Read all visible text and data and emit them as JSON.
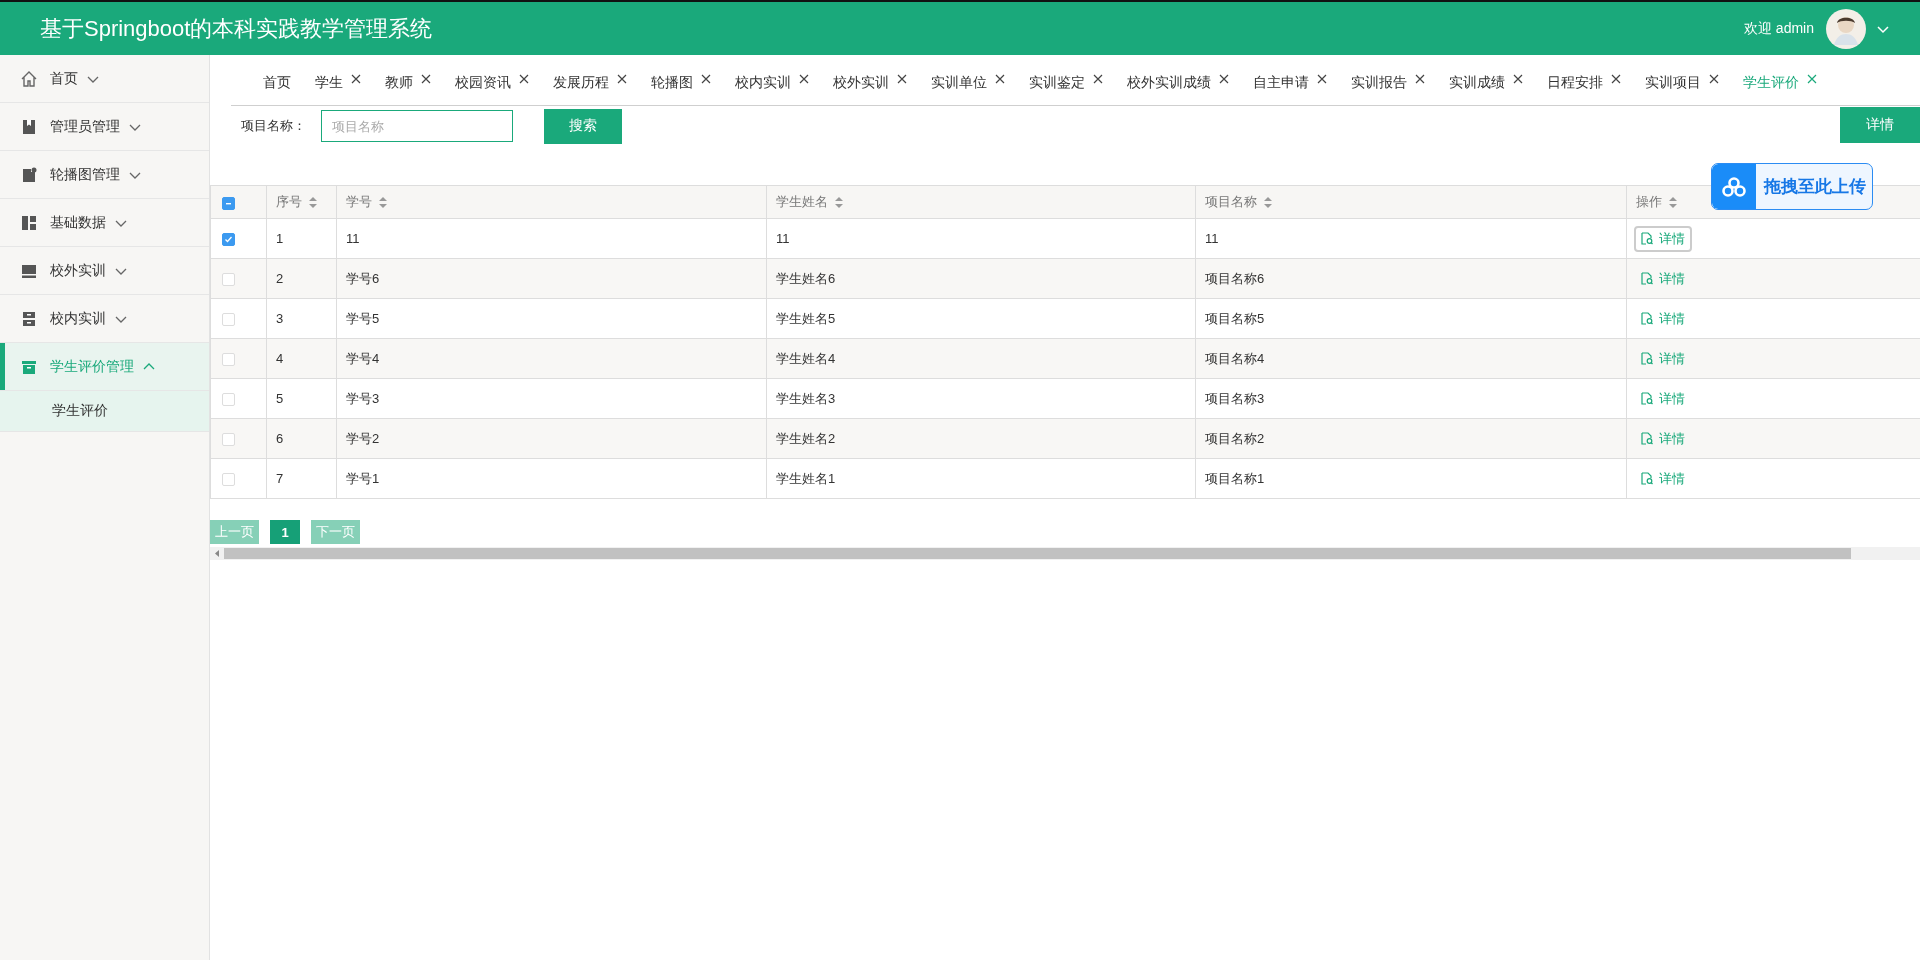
{
  "header": {
    "title": "基于Springboot的本科实践教学管理系统",
    "welcome": "欢迎 admin"
  },
  "sidebar": {
    "items": [
      {
        "label": "首页",
        "expanded": false,
        "selected": false
      },
      {
        "label": "管理员管理",
        "expanded": false,
        "selected": false
      },
      {
        "label": "轮播图管理",
        "expanded": false,
        "selected": false
      },
      {
        "label": "基础数据",
        "expanded": false,
        "selected": false
      },
      {
        "label": "校外实训",
        "expanded": false,
        "selected": false
      },
      {
        "label": "校内实训",
        "expanded": false,
        "selected": false
      },
      {
        "label": "学生评价管理",
        "expanded": true,
        "selected": true,
        "children": [
          {
            "label": "学生评价",
            "selected": true
          }
        ]
      }
    ]
  },
  "tabs": [
    {
      "label": "首页",
      "selected": false,
      "closable": false
    },
    {
      "label": "学生",
      "selected": false,
      "closable": true
    },
    {
      "label": "教师",
      "selected": false,
      "closable": true
    },
    {
      "label": "校园资讯",
      "selected": false,
      "closable": true
    },
    {
      "label": "发展历程",
      "selected": false,
      "closable": true
    },
    {
      "label": "轮播图",
      "selected": false,
      "closable": true
    },
    {
      "label": "校内实训",
      "selected": false,
      "closable": true
    },
    {
      "label": "校外实训",
      "selected": false,
      "closable": true
    },
    {
      "label": "实训单位",
      "selected": false,
      "closable": true
    },
    {
      "label": "实训鉴定",
      "selected": false,
      "closable": true
    },
    {
      "label": "校外实训成绩",
      "selected": false,
      "closable": true
    },
    {
      "label": "自主申请",
      "selected": false,
      "closable": true
    },
    {
      "label": "实训报告",
      "selected": false,
      "closable": true
    },
    {
      "label": "实训成绩",
      "selected": false,
      "closable": true
    },
    {
      "label": "日程安排",
      "selected": false,
      "closable": true
    },
    {
      "label": "实训项目",
      "selected": false,
      "closable": true
    },
    {
      "label": "学生评价",
      "selected": true,
      "closable": true
    }
  ],
  "search": {
    "label": "项目名称：",
    "placeholder": "项目名称",
    "button": "搜索",
    "detail_button": "详情"
  },
  "table": {
    "select_all": {
      "indeterminate": true
    },
    "columns": [
      {
        "label": "序号",
        "sortable": true
      },
      {
        "label": "学号",
        "sortable": true
      },
      {
        "label": "学生姓名",
        "sortable": true
      },
      {
        "label": "项目名称",
        "sortable": true
      },
      {
        "label": "操作",
        "sortable": true
      }
    ],
    "rows": [
      {
        "checked": true,
        "focused": true,
        "cells": [
          "1",
          "11",
          "11",
          "11"
        ],
        "action": "详情"
      },
      {
        "checked": false,
        "focused": false,
        "cells": [
          "2",
          "学号6",
          "学生姓名6",
          "项目名称6"
        ],
        "action": "详情"
      },
      {
        "checked": false,
        "focused": false,
        "cells": [
          "3",
          "学号5",
          "学生姓名5",
          "项目名称5"
        ],
        "action": "详情"
      },
      {
        "checked": false,
        "focused": false,
        "cells": [
          "4",
          "学号4",
          "学生姓名4",
          "项目名称4"
        ],
        "action": "详情"
      },
      {
        "checked": false,
        "focused": false,
        "cells": [
          "5",
          "学号3",
          "学生姓名3",
          "项目名称3"
        ],
        "action": "详情"
      },
      {
        "checked": false,
        "focused": false,
        "cells": [
          "6",
          "学号2",
          "学生姓名2",
          "项目名称2"
        ],
        "action": "详情"
      },
      {
        "checked": false,
        "focused": false,
        "cells": [
          "7",
          "学号1",
          "学生姓名1",
          "项目名称1"
        ],
        "action": "详情"
      }
    ]
  },
  "pagination": {
    "prev": "上一页",
    "pages": [
      {
        "label": "1",
        "selected": true
      }
    ],
    "next": "下一页"
  },
  "upload_widget": {
    "label": "拖拽至此上传"
  }
}
